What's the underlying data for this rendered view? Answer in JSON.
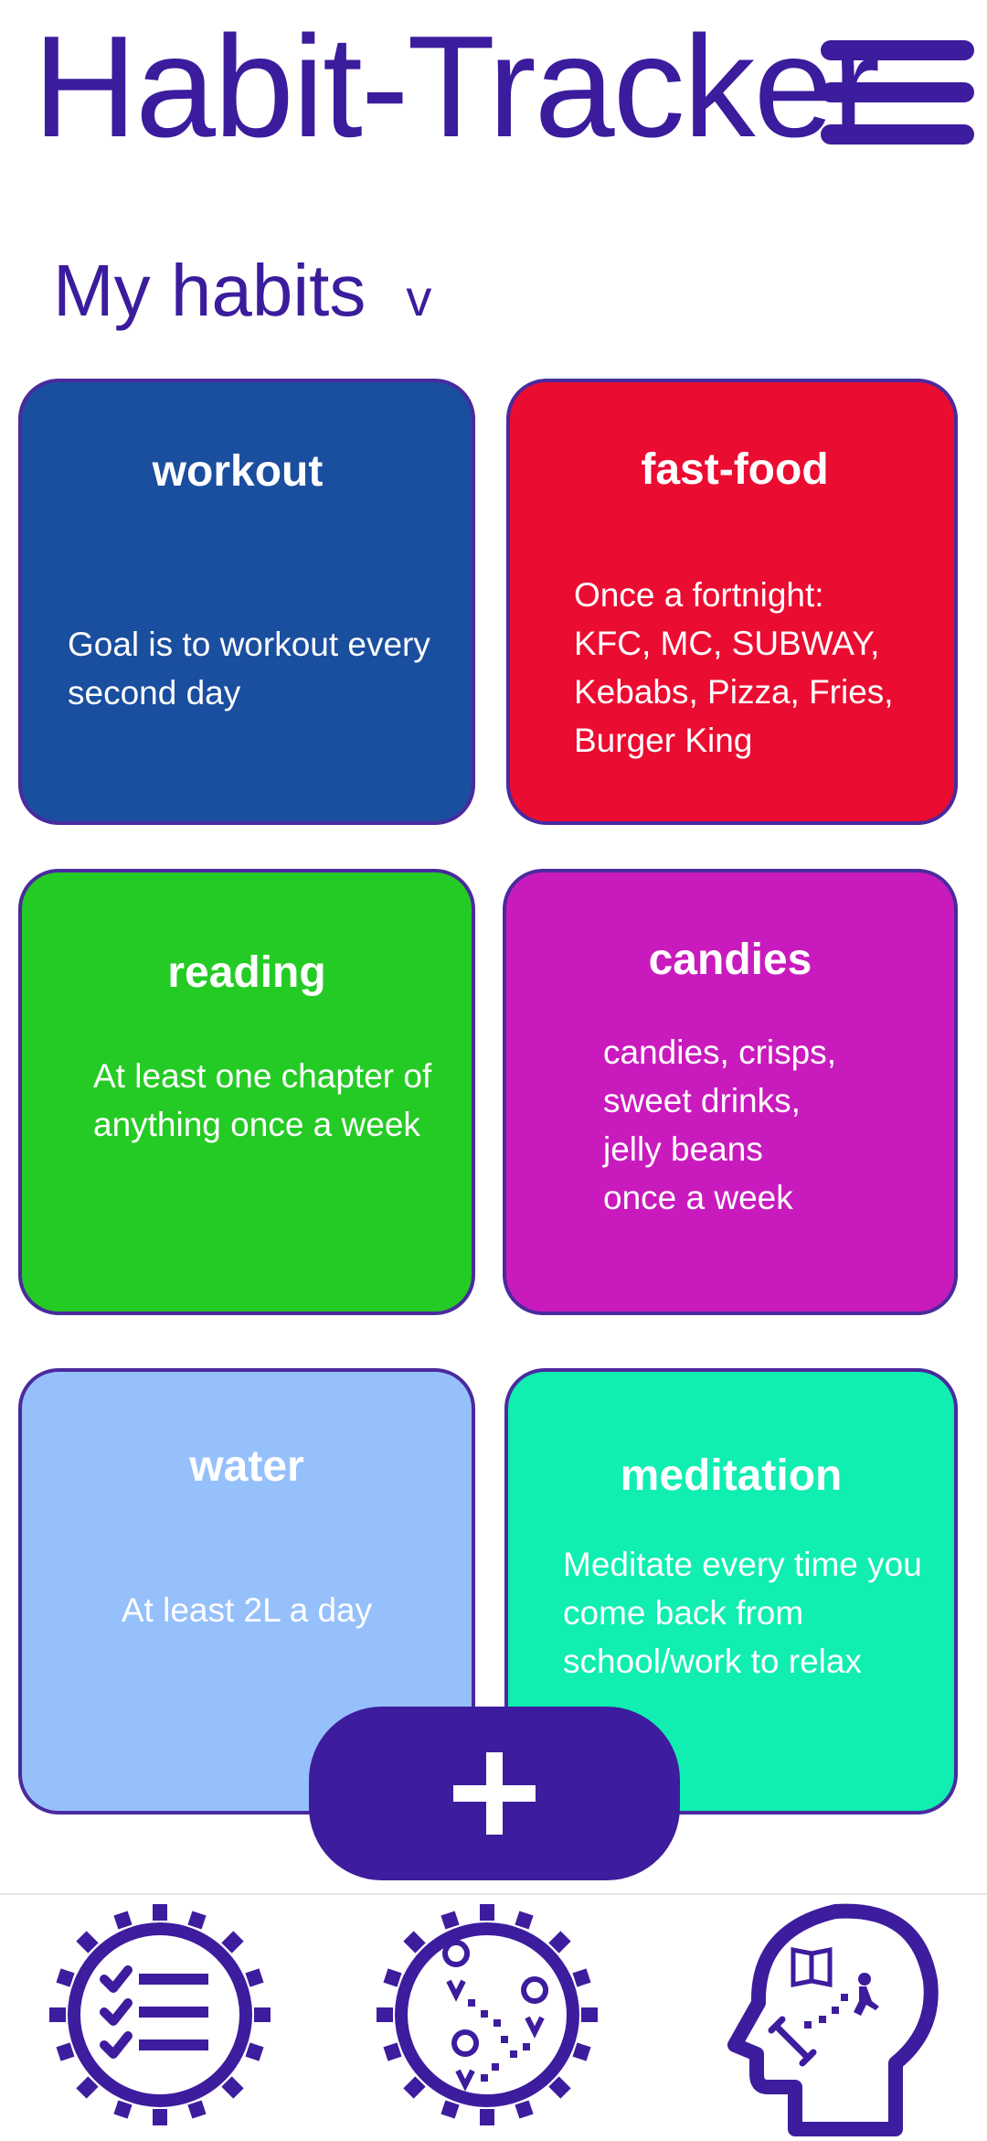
{
  "app": {
    "title": "Habit-Tracker"
  },
  "header": {
    "menu_icon": "hamburger-menu-icon"
  },
  "section": {
    "title": "My habits",
    "chevron": "v"
  },
  "habits": [
    {
      "title": "workout",
      "description": "Goal is to workout every\nsecond day",
      "color": "#1a4e9e"
    },
    {
      "title": "fast-food",
      "description": "Once a fortnight:\nKFC, MC, SUBWAY,\nKebabs, Pizza, Fries,\nBurger King",
      "color": "#eb0c31"
    },
    {
      "title": "reading",
      "description": "At least one chapter of\nanything once a week",
      "color": "#25cb25"
    },
    {
      "title": "candies",
      "description": "candies, crisps,\nsweet drinks,\njelly beans\nonce a week",
      "color": "#c91bbd"
    },
    {
      "title": "water",
      "description": "At least 2L a day",
      "color": "#96c0fb"
    },
    {
      "title": "meditation",
      "description": "Meditate every time you\ncome back from\nschool/work to relax",
      "color": "#10eeb2"
    }
  ],
  "fab": {
    "icon": "plus-icon"
  },
  "bottom_nav": [
    {
      "icon": "habit-list-icon"
    },
    {
      "icon": "map-progress-icon"
    },
    {
      "icon": "mind-profile-icon"
    }
  ],
  "colors": {
    "brand": "#3d1c9e",
    "border": "#4a2a9e",
    "background": "#ffffff"
  }
}
